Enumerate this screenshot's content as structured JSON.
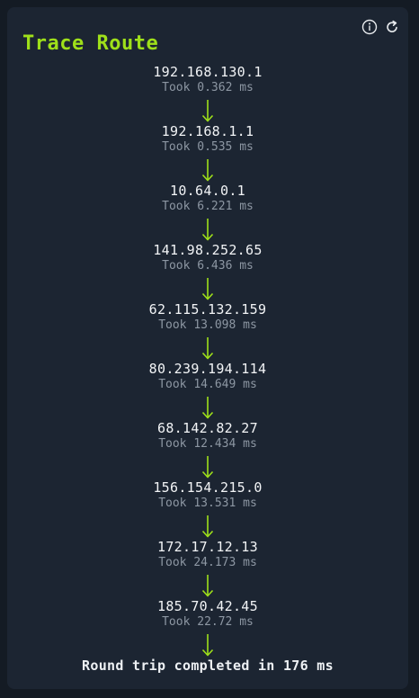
{
  "widget": {
    "title": "Trace Route",
    "info_icon": "info-icon",
    "refresh_icon": "refresh-icon"
  },
  "hops": [
    {
      "ip": "192.168.130.1",
      "time": "Took 0.362 ms"
    },
    {
      "ip": "192.168.1.1",
      "time": "Took 0.535 ms"
    },
    {
      "ip": "10.64.0.1",
      "time": "Took 6.221 ms"
    },
    {
      "ip": "141.98.252.65",
      "time": "Took 6.436 ms"
    },
    {
      "ip": "62.115.132.159",
      "time": "Took 13.098 ms"
    },
    {
      "ip": "80.239.194.114",
      "time": "Took 14.649 ms"
    },
    {
      "ip": "68.142.82.27",
      "time": "Took 12.434 ms"
    },
    {
      "ip": "156.154.215.0",
      "time": "Took 13.531 ms"
    },
    {
      "ip": "172.17.12.13",
      "time": "Took 24.173 ms"
    },
    {
      "ip": "185.70.42.45",
      "time": "Took 22.72 ms"
    }
  ],
  "summary": "Round trip completed in 176 ms",
  "colors": {
    "accent": "#9fe01a",
    "card": "#1c2532",
    "background": "#141b24"
  }
}
